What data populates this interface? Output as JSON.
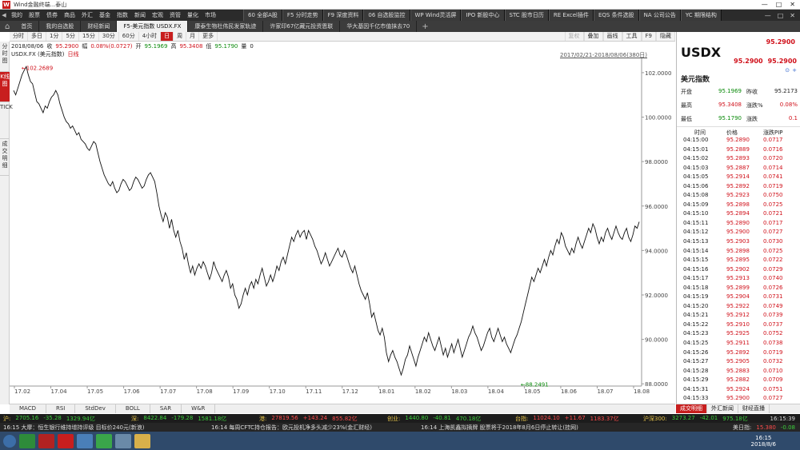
{
  "window": {
    "title": "Wind金融终端...泰山",
    "logo": "W",
    "controls": [
      "—",
      "□",
      "✕"
    ]
  },
  "menubar": {
    "menus": [
      "我的",
      "股票",
      "债券",
      "商品",
      "外汇",
      "基金",
      "指数",
      "新闻",
      "宏观",
      "资管",
      "量化",
      "市场"
    ],
    "quick": [
      "60 全部A股",
      "F5 分时走势",
      "F9 深度资料",
      "06 自选股监控",
      "WP Wind灵活屏",
      "IPO 新股中心",
      "STC 股市日历",
      "RE Excel插件",
      "EQS 条件选股",
      "NA 公司公告",
      "YC 期限结构"
    ],
    "controls": [
      "—",
      "□",
      "✕"
    ]
  },
  "tabs": [
    "首页",
    "我的自选股",
    "财经新闻",
    "F5-美元指数 USDX.FX",
    "康泰生物杜伟民发家轨迹",
    "许家印67亿藏元投资恩联",
    "华大基因千亿市值抹去70"
  ],
  "active_tab_index": 3,
  "toolbar": {
    "periods": [
      "分时",
      "多日",
      "1分",
      "5分",
      "15分",
      "30分",
      "60分",
      "4小时",
      "日",
      "周",
      "月",
      "更多"
    ],
    "active_period_index": 8,
    "right": [
      "复权",
      "叠加",
      "画线",
      "工具",
      "F9",
      "隐藏"
    ]
  },
  "left_strip": [
    "分时图",
    "K线图",
    "TICK",
    "成交明细"
  ],
  "info_line": {
    "date": "2018/08/06",
    "close_label": "收",
    "close": "95.2900",
    "chg_label": "幅",
    "chg": "0.08%(0.0727)",
    "open_label": "开",
    "open": "95.1969",
    "high_label": "高",
    "high": "95.3408",
    "low_label": "低",
    "low": "95.1790",
    "vol_label": "量",
    "vol": "0"
  },
  "second_line": {
    "code": "USDX.FX (美元指数)",
    "period": "日线"
  },
  "date_range": "2017/02/21-2018/08/06(380日)",
  "chart_data": {
    "type": "line",
    "title": "",
    "xlabel": "",
    "ylabel": "",
    "x_ticks": [
      "17.02",
      "17.04",
      "17.05",
      "17.06",
      "17.07",
      "17.08",
      "17.09",
      "17.10",
      "17.11",
      "17.12",
      "18.01",
      "18.02",
      "18.03",
      "18.04",
      "18.05",
      "18.06",
      "18.07",
      "18.08"
    ],
    "y_ticks": [
      "102.0000",
      "100.0000",
      "98.0000",
      "96.0000",
      "94.0000",
      "92.0000",
      "90.0000",
      "88.0000"
    ],
    "ylim": [
      87.9,
      102.5
    ],
    "annotations": [
      {
        "label": "←102.2689",
        "x": 3,
        "y": 102.2689
      },
      {
        "label": "←88.2491",
        "x": 240,
        "y": 88.2491
      }
    ],
    "series": [
      {
        "values": [
          101.2,
          101.0,
          101.3,
          101.6,
          101.9,
          102.1,
          102.2689,
          101.9,
          101.6,
          101.5,
          101.1,
          100.7,
          100.6,
          100.4,
          100.2,
          100.5,
          100.4,
          100.7,
          100.9,
          101.0,
          101.2,
          101.0,
          100.6,
          100.3,
          100.0,
          99.8,
          99.7,
          99.5,
          99.6,
          99.4,
          99.2,
          99.3,
          99.0,
          98.9,
          98.8,
          98.6,
          98.5,
          98.7,
          98.9,
          98.8,
          98.4,
          98.0,
          97.7,
          97.4,
          97.2,
          97.0,
          96.9,
          97.1,
          96.8,
          96.6,
          96.7,
          97.0,
          97.2,
          97.1,
          96.9,
          96.7,
          96.8,
          97.1,
          97.3,
          97.2,
          97.0,
          96.8,
          96.9,
          97.2,
          97.4,
          97.5,
          97.3,
          97.1,
          96.6,
          96.0,
          95.6,
          95.3,
          95.7,
          95.5,
          95.0,
          95.4,
          94.9,
          94.6,
          94.9,
          94.4,
          94.1,
          93.6,
          93.9,
          93.4,
          93.0,
          93.3,
          92.9,
          93.2,
          93.4,
          93.2,
          93.5,
          93.3,
          93.0,
          92.7,
          93.0,
          93.5,
          93.2,
          93.0,
          92.8,
          92.6,
          92.9,
          93.1,
          92.8,
          92.3,
          92.5,
          92.0,
          91.8,
          91.4,
          91.6,
          92.0,
          92.3,
          92.0,
          92.4,
          92.6,
          92.3,
          92.7,
          92.5,
          92.9,
          93.2,
          92.8,
          92.4,
          92.6,
          92.9,
          92.6,
          92.9,
          93.3,
          93.1,
          93.5,
          93.7,
          93.4,
          93.8,
          94.2,
          94.6,
          94.4,
          94.7,
          94.9,
          94.6,
          94.8,
          94.9,
          94.5,
          94.9,
          94.7,
          94.5,
          94.2,
          94.0,
          93.7,
          93.4,
          93.6,
          93.9,
          93.6,
          93.3,
          93.5,
          93.7,
          93.9,
          94.1,
          93.8,
          93.7,
          94.0,
          93.8,
          93.5,
          93.2,
          93.0,
          93.3,
          92.9,
          92.5,
          92.2,
          92.0,
          91.8,
          92.1,
          91.6,
          91.0,
          91.2,
          90.8,
          90.4,
          90.2,
          90.5,
          90.1,
          89.4,
          89.0,
          89.3,
          89.5,
          89.2,
          89.0,
          88.7,
          88.4,
          88.7,
          89.1,
          89.3,
          89.7,
          89.4,
          89.1,
          88.8,
          89.2,
          89.5,
          89.8,
          90.1,
          89.9,
          90.3,
          90.0,
          89.7,
          89.5,
          89.8,
          90.1,
          89.7,
          89.3,
          89.6,
          89.2,
          89.5,
          89.8,
          89.4,
          89.7,
          90.0,
          89.6,
          89.2,
          89.5,
          89.8,
          90.1,
          90.3,
          90.6,
          90.3,
          90.1,
          89.8,
          89.5,
          89.7,
          90.0,
          90.3,
          90.5,
          90.1,
          89.9,
          90.2,
          90.5,
          90.2,
          89.9,
          90.1,
          89.8,
          89.6,
          89.4,
          89.7,
          90.0,
          90.2,
          90.5,
          90.8,
          91.2,
          91.6,
          92.0,
          92.4,
          92.8,
          92.6,
          92.9,
          93.2,
          93.0,
          93.3,
          93.6,
          93.3,
          93.7,
          94.0,
          93.8,
          94.2,
          94.5,
          94.3,
          94.8,
          94.6,
          94.2,
          94.0,
          93.8,
          94.1,
          93.9,
          94.3,
          94.6,
          94.3,
          94.1,
          94.4,
          94.7,
          95.0,
          94.8,
          95.2,
          95.0,
          94.6,
          94.3,
          94.6,
          94.4,
          94.8,
          95.0,
          94.7,
          94.5,
          94.8,
          95.1,
          94.8,
          94.6,
          94.5,
          94.8,
          95.0,
          94.6,
          94.4,
          94.7,
          95.1,
          95.0,
          95.29
        ]
      }
    ]
  },
  "indicator_tabs": [
    "MACD",
    "RSI",
    "StdDev",
    "BOLL",
    "SAR",
    "W&R"
  ],
  "right_panel": {
    "symbol": "USDX",
    "big_price": "95.2900",
    "bid": "95.2900",
    "ask": "95.2900",
    "icons": [
      "⊙",
      "+"
    ],
    "name": "美元指数",
    "quotes": [
      {
        "l1": "开盘",
        "v1": "95.1969",
        "c1": "green",
        "l2": "昨收",
        "v2": "95.2173",
        "c2": "black"
      },
      {
        "l1": "最高",
        "v1": "95.3408",
        "c1": "red",
        "l2": "涨跌%",
        "v2": "0.08%",
        "c2": "red"
      },
      {
        "l1": "最低",
        "v1": "95.1790",
        "c1": "green",
        "l2": "涨跌",
        "v2": "0.1",
        "c2": "red"
      }
    ],
    "headers": [
      "时间",
      "价格",
      "涨跌PIP"
    ],
    "ticks": [
      [
        "04:15:00",
        "95.2890",
        "0.0717"
      ],
      [
        "04:15:01",
        "95.2889",
        "0.0716"
      ],
      [
        "04:15:02",
        "95.2893",
        "0.0720"
      ],
      [
        "04:15:03",
        "95.2887",
        "0.0714"
      ],
      [
        "04:15:05",
        "95.2914",
        "0.0741"
      ],
      [
        "04:15:06",
        "95.2892",
        "0.0719"
      ],
      [
        "04:15:08",
        "95.2923",
        "0.0750"
      ],
      [
        "04:15:09",
        "95.2898",
        "0.0725"
      ],
      [
        "04:15:10",
        "95.2894",
        "0.0721"
      ],
      [
        "04:15:11",
        "95.2890",
        "0.0717"
      ],
      [
        "04:15:12",
        "95.2900",
        "0.0727"
      ],
      [
        "04:15:13",
        "95.2903",
        "0.0730"
      ],
      [
        "04:15:14",
        "95.2898",
        "0.0725"
      ],
      [
        "04:15:15",
        "95.2895",
        "0.0722"
      ],
      [
        "04:15:16",
        "95.2902",
        "0.0729"
      ],
      [
        "04:15:17",
        "95.2913",
        "0.0740"
      ],
      [
        "04:15:18",
        "95.2899",
        "0.0726"
      ],
      [
        "04:15:19",
        "95.2904",
        "0.0731"
      ],
      [
        "04:15:20",
        "95.2922",
        "0.0749"
      ],
      [
        "04:15:21",
        "95.2912",
        "0.0739"
      ],
      [
        "04:15:22",
        "95.2910",
        "0.0737"
      ],
      [
        "04:15:23",
        "95.2925",
        "0.0752"
      ],
      [
        "04:15:25",
        "95.2911",
        "0.0738"
      ],
      [
        "04:15:26",
        "95.2892",
        "0.0719"
      ],
      [
        "04:15:27",
        "95.2905",
        "0.0732"
      ],
      [
        "04:15:28",
        "95.2883",
        "0.0710"
      ],
      [
        "04:15:29",
        "95.2882",
        "0.0709"
      ],
      [
        "04:15:31",
        "95.2924",
        "0.0751"
      ],
      [
        "04:15:33",
        "95.2900",
        "0.0727"
      ]
    ],
    "tabs": [
      "成交明细",
      "外汇新闻",
      "财经直播"
    ],
    "active_tab_index": 0
  },
  "market_bar": [
    {
      "name": "沪:",
      "v": "2705.16",
      "c": "-35.28",
      "a": "1329.94亿",
      "dir": "down"
    },
    {
      "name": "深:",
      "v": "8422.84",
      "c": "-179.28",
      "a": "1581.18亿",
      "dir": "down"
    },
    {
      "name": "港:",
      "v": "27819.56",
      "c": "+143.24",
      "a": "855.82亿",
      "dir": "up"
    },
    {
      "name": "创业:",
      "v": "1440.80",
      "c": "-40.81",
      "a": "470.18亿",
      "dir": "down"
    },
    {
      "name": "台指:",
      "v": "11024.10",
      "c": "+11.67",
      "a": "1183.37亿",
      "dir": "up"
    },
    {
      "name": "沪深300:",
      "v": "3273.27",
      "c": "-42.01",
      "a": "975.18亿",
      "dir": "down"
    }
  ],
  "market_time": "16:15:39",
  "news_bar": {
    "n1": "16:15 大摩：恒生银行维持增持评级 目标价240元(新浪)",
    "n2": "16:14 每周CFTC持仓报告：欧元投机净多头减少23%(金汇财经)",
    "n3": "16:14 上海凯鑫拟摘牌 股票将于2018年8月6日停止转让(挂网)",
    "idx_name": "美日指:",
    "idx_v": "15.380",
    "idx_c": "-0.08"
  },
  "taskbar": {
    "time": "16:15",
    "date": "2018/8/6"
  },
  "colors": {
    "up": "#d0101a",
    "down": "#0a8a0a",
    "accent": "#c81e1e"
  }
}
